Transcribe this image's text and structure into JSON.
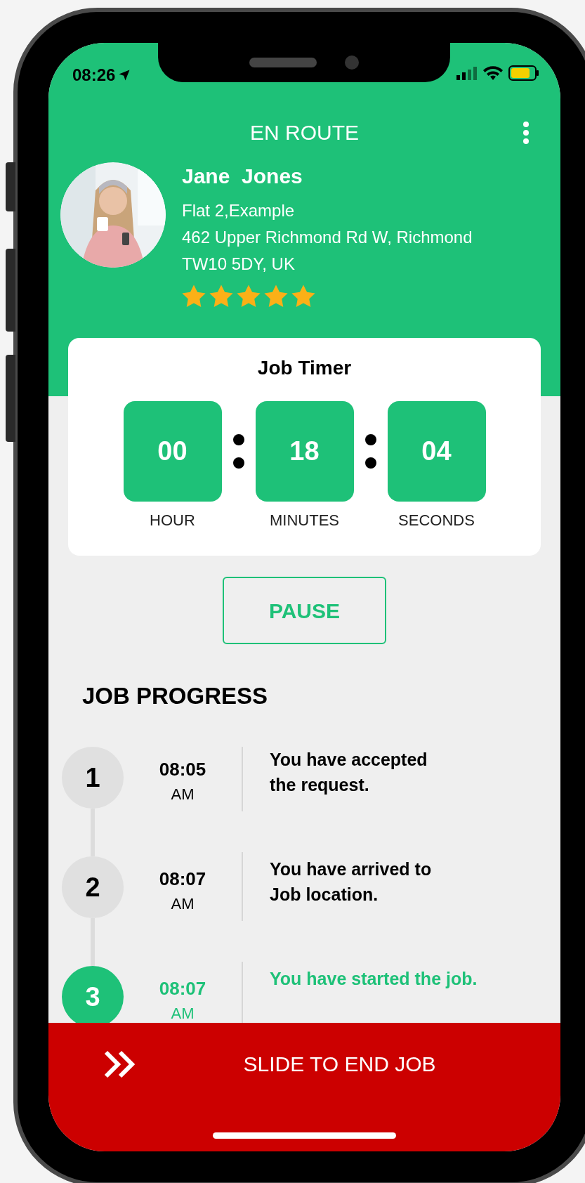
{
  "status_bar": {
    "time": "08:26"
  },
  "header": {
    "title": "EN ROUTE"
  },
  "customer": {
    "name": "Jane  Jones",
    "address_lines": [
      "Flat 2,Example",
      "462 Upper Richmond Rd W,  Richmond",
      "TW10 5DY,  UK"
    ],
    "stars": 5
  },
  "timer": {
    "title": "Job Timer",
    "units": [
      {
        "value": "00",
        "label": "HOUR"
      },
      {
        "value": "18",
        "label": "MINUTES"
      },
      {
        "value": "04",
        "label": "SECONDS"
      }
    ]
  },
  "pause_button": {
    "label": "PAUSE"
  },
  "progress": {
    "title": "JOB PROGRESS",
    "steps": [
      {
        "number": "1",
        "time": "08:05",
        "period": "AM",
        "text": "You have accepted\nthe request.",
        "current": false
      },
      {
        "number": "2",
        "time": "08:07",
        "period": "AM",
        "text": "You have arrived to\nJob location.",
        "current": false
      },
      {
        "number": "3",
        "time": "08:07",
        "period": "AM",
        "text": "You have started the job.",
        "current": true
      }
    ]
  },
  "slide_bar": {
    "label": "SLIDE TO END JOB"
  }
}
